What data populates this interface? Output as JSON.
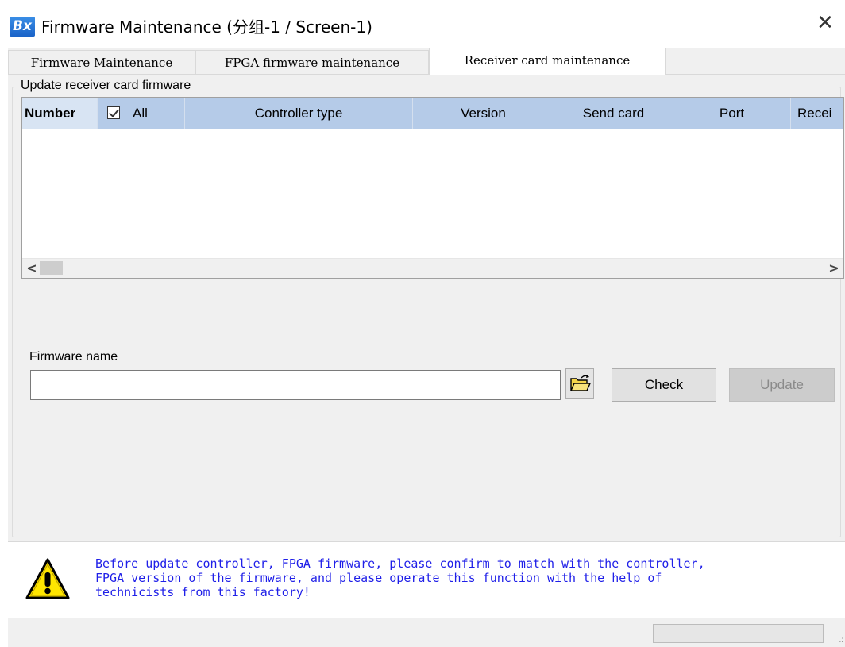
{
  "window": {
    "title": "Firmware Maintenance  (分组-1 / Screen-1)",
    "icon_text": "Bx",
    "close_glyph": "✕"
  },
  "tabs": [
    {
      "label": "Firmware Maintenance",
      "active": false
    },
    {
      "label": "FPGA firmware maintenance",
      "active": false
    },
    {
      "label": "Receiver card maintenance",
      "active": true
    }
  ],
  "group": {
    "legend": "Update receiver card firmware"
  },
  "grid": {
    "columns": [
      "Number",
      "All",
      "Controller type",
      "Version",
      "Send card",
      "Port",
      "Recei"
    ],
    "select_all_checked": true,
    "rows": [],
    "scroll_left": "<",
    "scroll_right": ">"
  },
  "firmware": {
    "label": "Firmware name",
    "value": "",
    "check_label": "Check",
    "update_label": "Update"
  },
  "warning": {
    "text": "Before update controller, FPGA firmware, please confirm to match with the controller,\nFPGA version of the firmware, and please operate this function with the help of\ntechnicists from this factory!",
    "color": "#1f1fe8"
  },
  "colors": {
    "header_bg": "#b5cbe8",
    "window_bg": "#f0f0f0"
  }
}
